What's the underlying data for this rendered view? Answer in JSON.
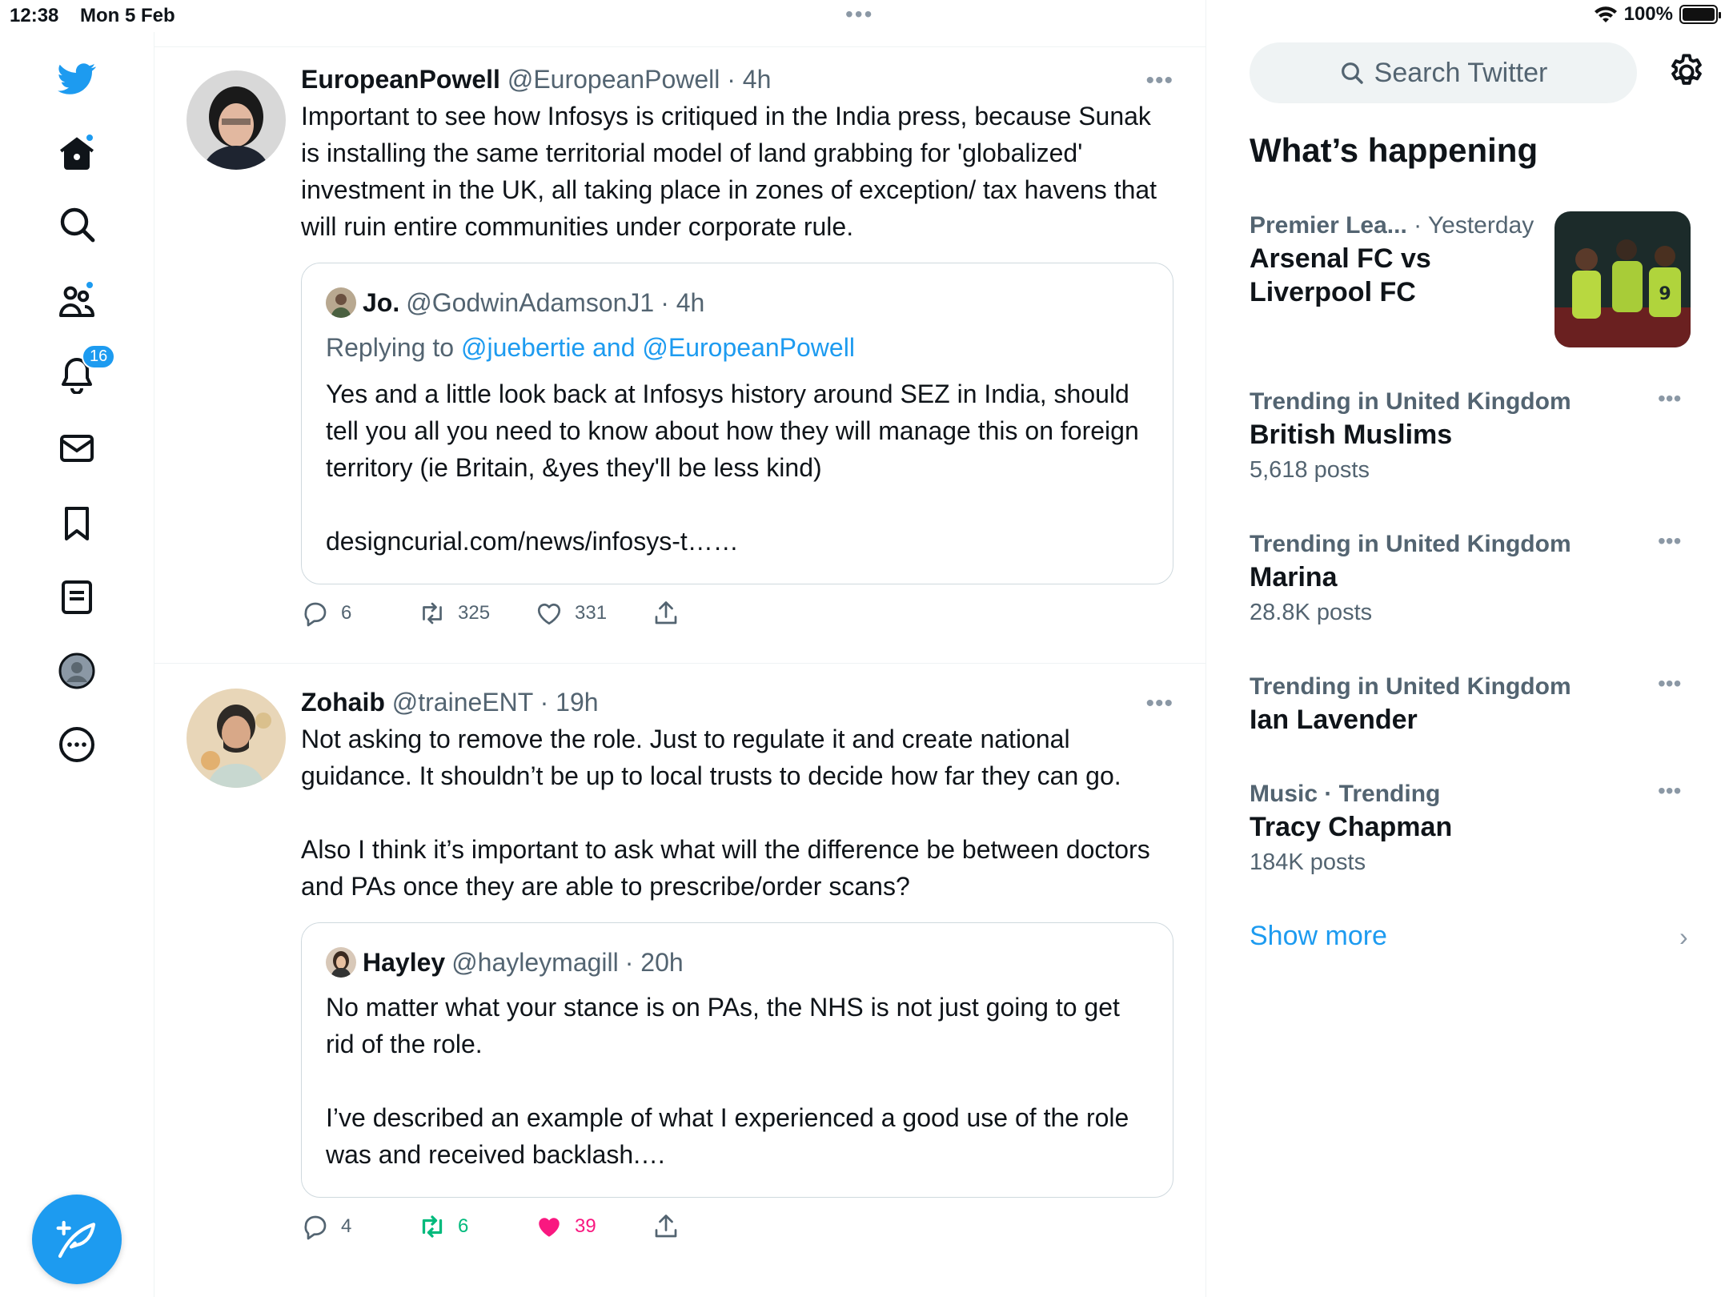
{
  "status_bar": {
    "time": "12:38",
    "date": "Mon 5 Feb",
    "battery": "100%",
    "battery_level": 1.0
  },
  "nav": {
    "items": [
      {
        "icon": "twitter-logo-icon"
      },
      {
        "icon": "home-icon",
        "has_dot": true
      },
      {
        "icon": "search-icon"
      },
      {
        "icon": "communities-icon",
        "has_dot": true
      },
      {
        "icon": "notifications-bell-icon",
        "badge": "16"
      },
      {
        "icon": "messages-envelope-icon"
      },
      {
        "icon": "bookmark-icon"
      },
      {
        "icon": "lists-icon"
      },
      {
        "icon": "profile-icon"
      },
      {
        "icon": "more-icon"
      }
    ],
    "compose_icon": "compose-feather-icon"
  },
  "colors": {
    "accent": "#1d9bf0",
    "text": "#0f1419",
    "muted": "#536471",
    "border": "#cfd9de",
    "like": "#f91880",
    "retweet": "#00ba7c"
  },
  "timeline": {
    "tweets": [
      {
        "name": "EuropeanPowell",
        "handle": "@EuropeanPowell",
        "time": "· 4h",
        "text": "Important to see how Infosys is critiqued in the India press, because Sunak is installing the same territorial model of land grabbing for 'globalized' investment in the UK, all taking place in zones of exception/ tax havens that will ruin entire communities under corporate rule.",
        "quote": {
          "name": "Jo.",
          "handle": "@GodwinAdamsonJ1",
          "time": "· 4h",
          "replying_prefix": "Replying to ",
          "replying_to": "@juebertie and @EuropeanPowell",
          "text": "Yes and a little look back at Infosys history around SEZ in India, should tell you all you need to know about how they will manage this on foreign territory (ie Britain, &yes they'll be less kind)\n\ndesigncurial.com/news/infosys-t……"
        },
        "replies": "6",
        "retweets": "325",
        "likes": "331",
        "liked": false,
        "retweeted": false
      },
      {
        "name": "Zohaib",
        "handle": "@traineENT",
        "time": "· 19h",
        "text": "Not asking to remove the role. Just to regulate it and create national guidance. It shouldn’t be up to local trusts to decide how far they can go.\n\nAlso I think it’s important to ask what will the difference be between doctors and PAs once they are able to prescribe/order scans?",
        "quote": {
          "name": "Hayley",
          "handle": "@hayleymagill",
          "time": "· 20h",
          "text": "No matter what your stance is on PAs, the NHS is not just going to get rid of the role.\n\nI’ve described an example of what I experienced a good use of the role was and received backlash.…"
        },
        "replies": "4",
        "retweets": "6",
        "likes": "39",
        "liked": true,
        "retweeted": true
      }
    ]
  },
  "right": {
    "search_placeholder": "Search Twitter",
    "whats_happening": "What’s happening",
    "trends": [
      {
        "meta": "Premier Lea...",
        "meta_suffix": " · Yesterday",
        "title": "Arsenal FC vs Liverpool FC",
        "sub": ""
      },
      {
        "meta": "Trending in United Kingdom",
        "title": "British Muslims",
        "sub": "5,618 posts"
      },
      {
        "meta": "Trending in United Kingdom",
        "title": "Marina",
        "sub": "28.8K posts"
      },
      {
        "meta": "Trending in United Kingdom",
        "title": "Ian Lavender",
        "sub": ""
      },
      {
        "meta": "Music · Trending",
        "title": "Tracy Chapman",
        "sub": "184K posts"
      }
    ],
    "show_more": "Show more"
  }
}
